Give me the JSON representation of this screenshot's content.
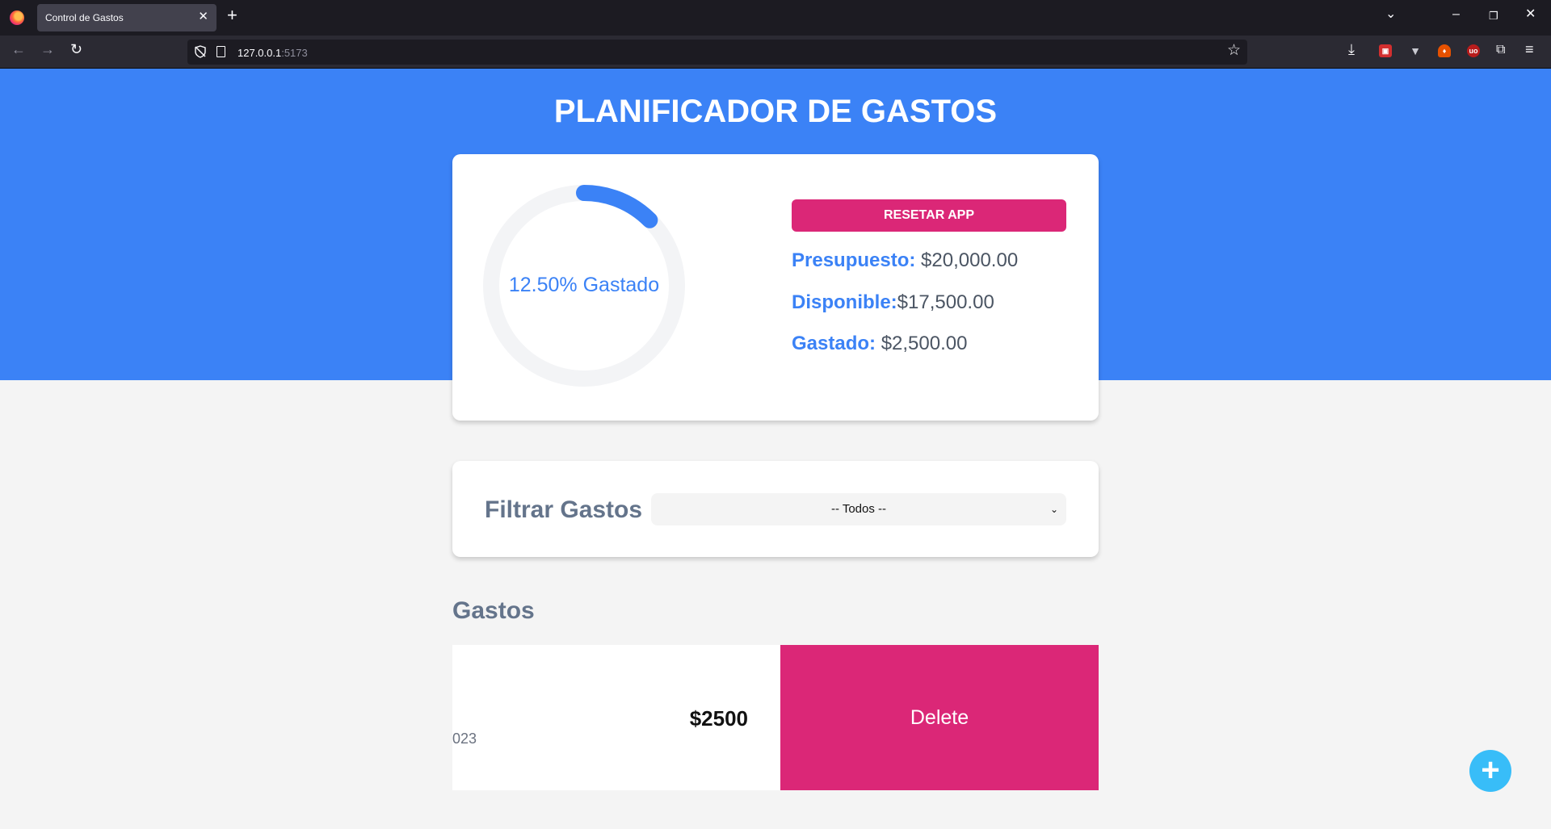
{
  "browser": {
    "tab_title": "Control de Gastos",
    "url_host": "127.0.0.1",
    "url_port": ":5173"
  },
  "app": {
    "title": "PLANIFICADOR DE GASTOS",
    "budget": {
      "percent_spent": 12.5,
      "percent_label": "12.50% Gastado",
      "reset_label": "RESETAR APP",
      "presupuesto_label": "Presupuesto:",
      "presupuesto_value": "$20,000.00",
      "disponible_label": "Disponible:",
      "disponible_value": "$17,500.00",
      "gastado_label": "Gastado:",
      "gastado_value": "$2,500.00"
    },
    "filter": {
      "label": "Filtrar Gastos",
      "selected": "-- Todos --"
    },
    "expenses": {
      "title": "Gastos",
      "items": [
        {
          "date_fragment": "023",
          "amount": "$2500",
          "delete_label": "Delete"
        }
      ]
    },
    "add_button": "+"
  },
  "colors": {
    "primary": "#3b82f6",
    "accent": "#db2777",
    "fab": "#38bdf8",
    "text_gray": "#64748b"
  }
}
